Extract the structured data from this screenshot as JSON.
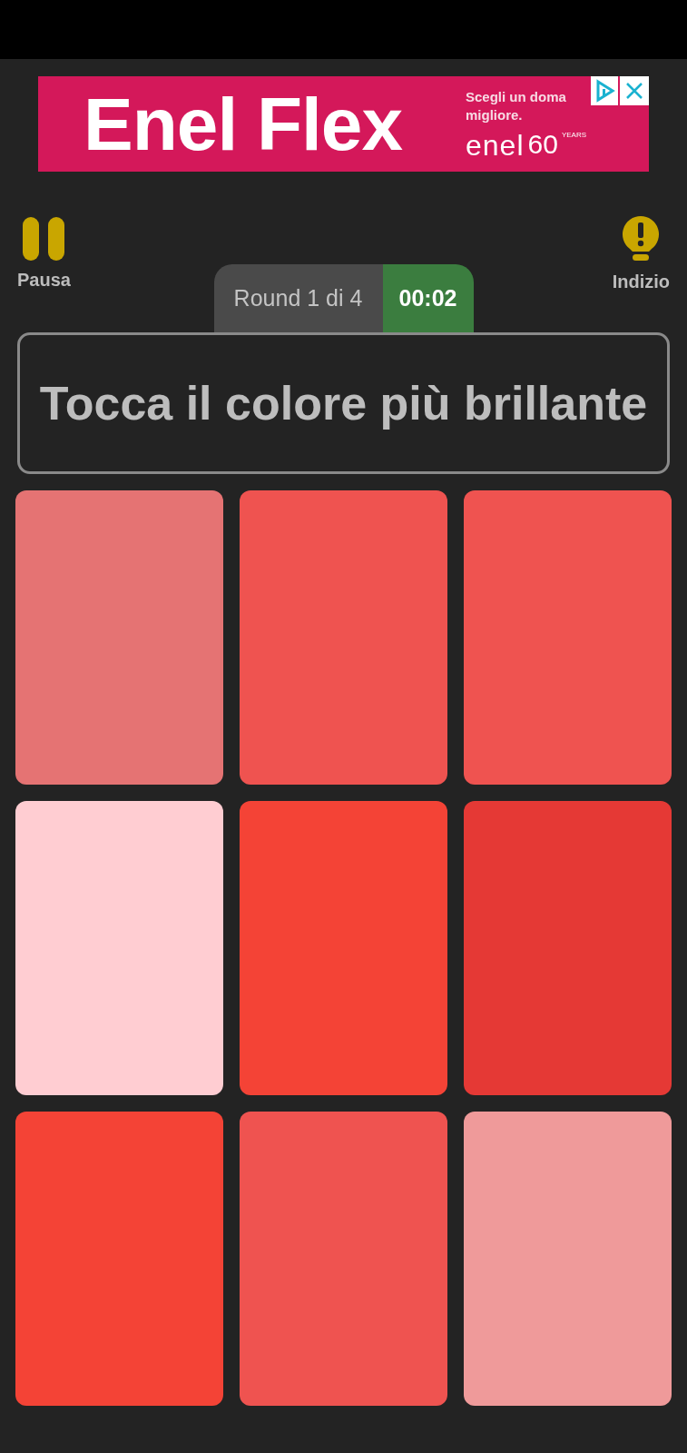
{
  "ad": {
    "headline": "Enel Flex",
    "tagline": "Scegli un doma",
    "tagline_2": "migliore.",
    "logo": "enel",
    "logo_badge": "60",
    "logo_small": "YEARS"
  },
  "toolbar": {
    "pause_label": "Pausa",
    "hint_label": "Indizio"
  },
  "round": {
    "label": "Round 1 di 4",
    "timer": "00:02"
  },
  "prompt": "Tocca il colore più brillante",
  "tiles": [
    {
      "color": "#e57373"
    },
    {
      "color": "#ef5350"
    },
    {
      "color": "#ef5350"
    },
    {
      "color": "#ffcdd2"
    },
    {
      "color": "#f44336"
    },
    {
      "color": "#e53935"
    },
    {
      "color": "#f44336"
    },
    {
      "color": "#ef5350"
    },
    {
      "color": "#ef9a9a"
    }
  ]
}
